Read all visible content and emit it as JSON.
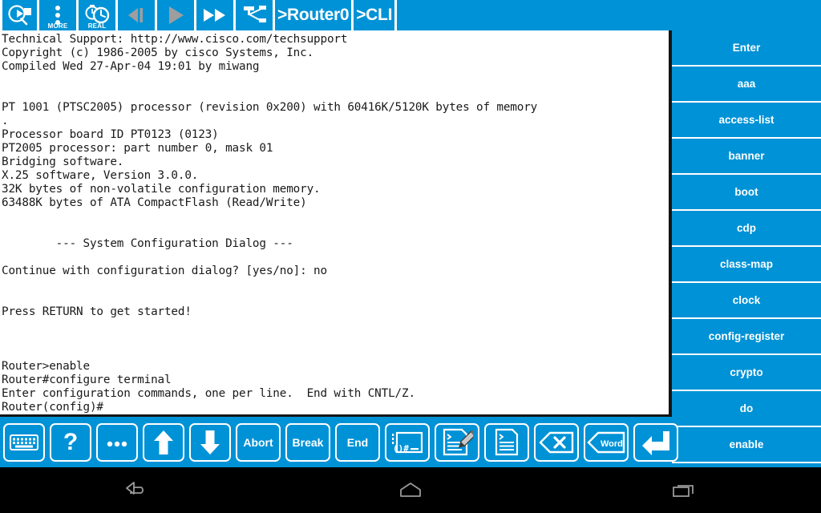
{
  "app": {
    "accent_blue": "#0092D6",
    "terminal_bg": "#FFFFFF",
    "terminal_fg": "#1A1A1A",
    "navbar_bg": "#000000"
  },
  "toolbar": {
    "buttons": [
      {
        "name": "inspect-icon",
        "icon": "camera-magnifier-icon",
        "label": "",
        "type": "icon"
      },
      {
        "name": "more-button",
        "icon": "more-vertical-icon",
        "label": "MORE",
        "type": "icon"
      },
      {
        "name": "realtime-button",
        "icon": "stopwatch-clock-icon",
        "label": "REAL",
        "type": "icon"
      },
      {
        "name": "step-back-button",
        "icon": "step-back-icon",
        "label": "",
        "type": "icon"
      },
      {
        "name": "play-button",
        "icon": "play-icon",
        "label": "",
        "type": "icon"
      },
      {
        "name": "fast-forward-button",
        "icon": "fast-forward-icon",
        "label": "",
        "type": "icon"
      },
      {
        "name": "topology-button",
        "icon": "topology-icon",
        "label": "",
        "type": "icon"
      }
    ],
    "breadcrumb_device": ">Router0",
    "breadcrumb_tab": ">CLI"
  },
  "terminal": {
    "lines": [
      "Technical Support: http://www.cisco.com/techsupport",
      "Copyright (c) 1986-2005 by cisco Systems, Inc.",
      "Compiled Wed 27-Apr-04 19:01 by miwang",
      "",
      "",
      "PT 1001 (PTSC2005) processor (revision 0x200) with 60416K/5120K bytes of memory",
      ".",
      "Processor board ID PT0123 (0123)",
      "PT2005 processor: part number 0, mask 01",
      "Bridging software.",
      "X.25 software, Version 3.0.0.",
      "32K bytes of non-volatile configuration memory.",
      "63488K bytes of ATA CompactFlash (Read/Write)",
      "",
      "",
      "        --- System Configuration Dialog ---",
      "",
      "Continue with configuration dialog? [yes/no]: no",
      "",
      "",
      "Press RETURN to get started!",
      "",
      "",
      "",
      "Router>enable",
      "Router#configure terminal",
      "Enter configuration commands, one per line.  End with CNTL/Z.",
      "Router(config)#"
    ]
  },
  "command_list": {
    "items": [
      {
        "label": "Enter"
      },
      {
        "label": "aaa"
      },
      {
        "label": "access-list"
      },
      {
        "label": "banner"
      },
      {
        "label": "boot"
      },
      {
        "label": "cdp"
      },
      {
        "label": "class-map"
      },
      {
        "label": "clock"
      },
      {
        "label": "config-register"
      },
      {
        "label": "crypto"
      },
      {
        "label": "do"
      },
      {
        "label": "enable"
      }
    ]
  },
  "keyrow": {
    "keys": [
      {
        "name": "keyboard-key",
        "icon": "keyboard-icon",
        "label": ""
      },
      {
        "name": "help-key",
        "icon": "question-mark-icon",
        "label": "?"
      },
      {
        "name": "ellipsis-key",
        "icon": "ellipsis-icon",
        "label": "..."
      },
      {
        "name": "arrow-up-key",
        "icon": "arrow-up-icon",
        "label": ""
      },
      {
        "name": "arrow-down-key",
        "icon": "arrow-down-icon",
        "label": ""
      },
      {
        "name": "abort-key",
        "icon": "",
        "label": "Abort"
      },
      {
        "name": "break-key",
        "icon": "",
        "label": "Break"
      },
      {
        "name": "end-key",
        "icon": "",
        "label": "End"
      },
      {
        "name": "console-key",
        "icon": "console-window-icon",
        "label": ""
      },
      {
        "name": "edit-config-key",
        "icon": "document-pencil-icon",
        "label": ""
      },
      {
        "name": "show-config-key",
        "icon": "document-icon",
        "label": ""
      },
      {
        "name": "backspace-key",
        "icon": "backspace-x-icon",
        "label": ""
      },
      {
        "name": "delete-word-key",
        "icon": "backspace-word-icon",
        "label": "Word"
      },
      {
        "name": "enter-key",
        "icon": "enter-arrow-icon",
        "label": ""
      }
    ]
  },
  "navbar": {
    "buttons": [
      {
        "name": "android-back-button",
        "icon": "back-arrow-icon"
      },
      {
        "name": "android-home-button",
        "icon": "home-icon"
      },
      {
        "name": "android-recents-button",
        "icon": "recents-icon"
      }
    ]
  }
}
